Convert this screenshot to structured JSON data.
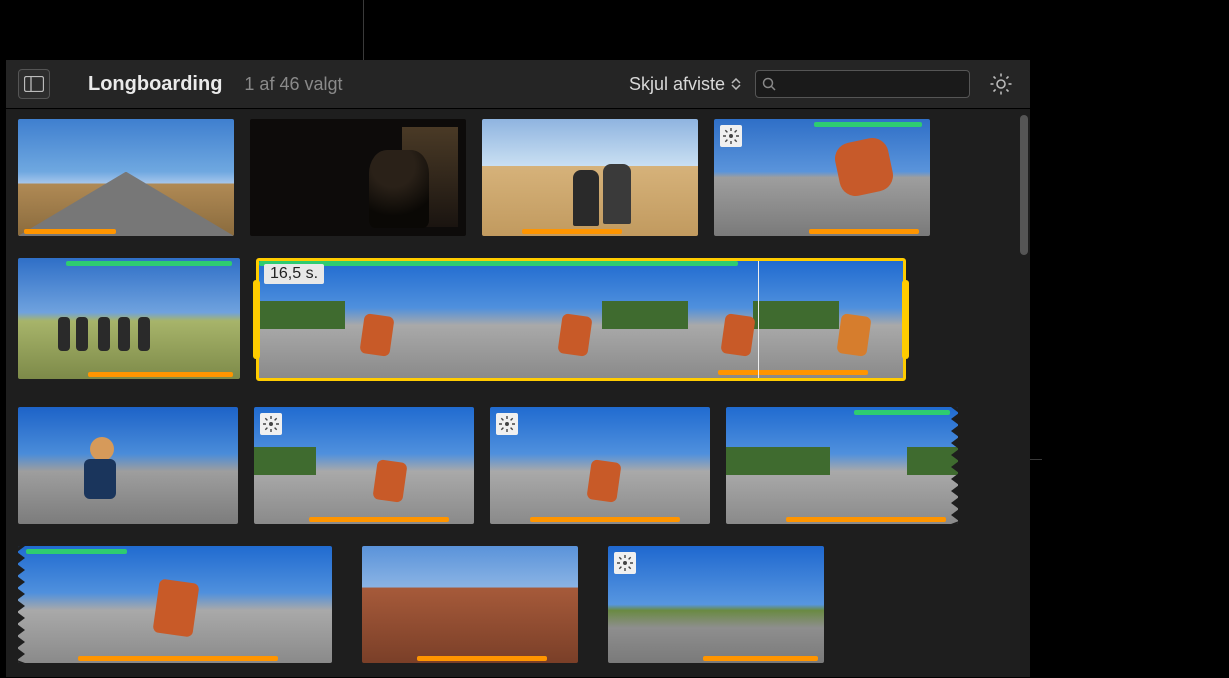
{
  "header": {
    "title": "Longboarding",
    "subtitle": "1 af 46 valgt",
    "filter_label": "Skjul afviste",
    "search_placeholder": ""
  },
  "icons": {
    "sidebar": "sidebar-toggle-icon",
    "search": "search-icon",
    "gear": "gear-icon",
    "chev_up": "chevron-up-icon",
    "chev_down": "chevron-down-icon",
    "keyword": "keyword-badge-icon"
  },
  "selection": {
    "duration_label": "16,5 s."
  },
  "colors": {
    "favorite": "#2ecc71",
    "used": "#ff9500",
    "selection": "#ffcc00"
  }
}
